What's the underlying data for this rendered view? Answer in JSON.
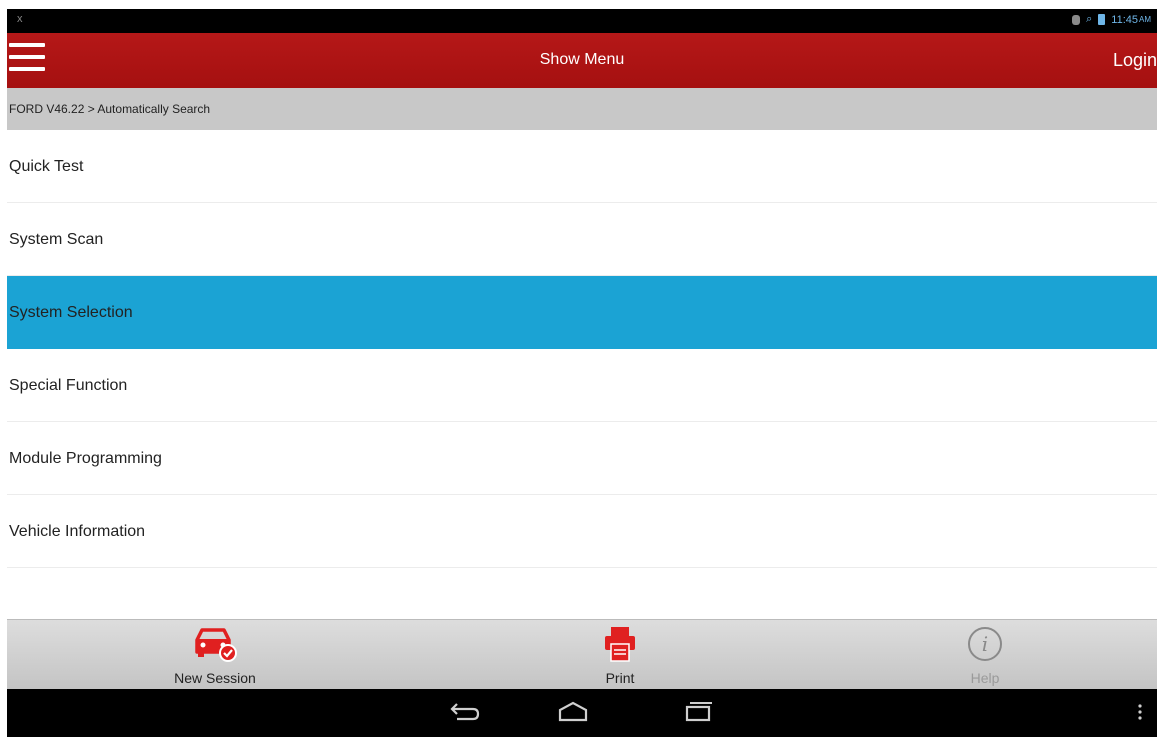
{
  "statusbar": {
    "time": "11:45",
    "ampm": "AM",
    "left_icon": "x"
  },
  "topbar": {
    "menu_icon": "hamburger-icon",
    "title": "Show Menu",
    "login_label": "Login"
  },
  "breadcrumb": {
    "text": "FORD V46.22 > Automatically Search"
  },
  "menu": {
    "selected_index": 2,
    "items": [
      {
        "label": "Quick Test"
      },
      {
        "label": "System Scan"
      },
      {
        "label": "System Selection"
      },
      {
        "label": "Special Function"
      },
      {
        "label": "Module Programming"
      },
      {
        "label": "Vehicle Information"
      }
    ]
  },
  "toolbar": {
    "new_session_label": "New Session",
    "print_label": "Print",
    "help_label": "Help"
  },
  "colors": {
    "topbar": "#a51010",
    "selected_item": "#1ba3d4",
    "accent_icon": "#e02020"
  }
}
